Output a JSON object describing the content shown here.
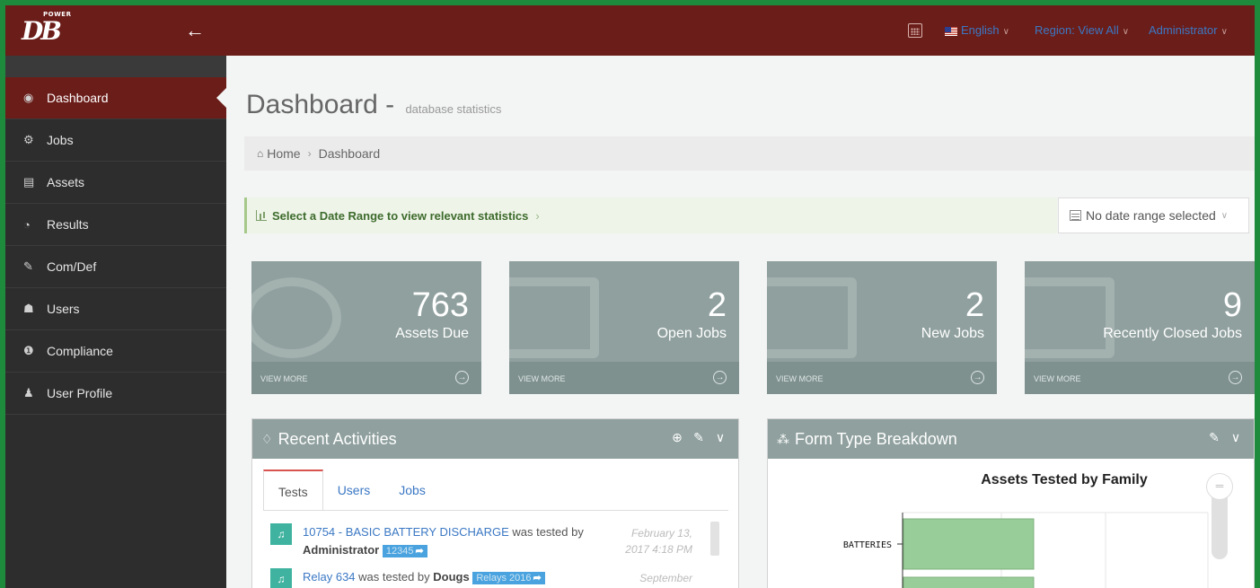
{
  "topbar": {
    "logo_small": "POWER",
    "logo_big": "DB",
    "language": "English",
    "region": "Region: View All",
    "user": "Administrator"
  },
  "sidebar": {
    "items": [
      {
        "label": "Dashboard",
        "icon": "dashboard-icon",
        "glyph": "◉",
        "active": true
      },
      {
        "label": "Jobs",
        "icon": "jobs-icon",
        "glyph": "⚙",
        "active": false
      },
      {
        "label": "Assets",
        "icon": "assets-icon",
        "glyph": "▤",
        "active": false
      },
      {
        "label": "Results",
        "icon": "results-icon",
        "glyph": "◔",
        "active": false
      },
      {
        "label": "Com/Def",
        "icon": "comments-icon",
        "glyph": "✎",
        "active": false
      },
      {
        "label": "Users",
        "icon": "users-icon",
        "glyph": "☗",
        "active": false
      },
      {
        "label": "Compliance",
        "icon": "info-icon",
        "glyph": "❶",
        "active": false
      },
      {
        "label": "User Profile",
        "icon": "user-icon",
        "glyph": "♟",
        "active": false
      }
    ]
  },
  "header": {
    "title": "Dashboard",
    "separator": " - ",
    "subtitle": "database statistics"
  },
  "breadcrumb": {
    "home": "Home",
    "current": "Dashboard"
  },
  "date_range": {
    "prompt": "Select a Date Range to view relevant statistics",
    "selected": "No date range selected"
  },
  "tiles": [
    {
      "value": "763",
      "label": "Assets Due",
      "more": "VIEW MORE"
    },
    {
      "value": "2",
      "label": "Open Jobs",
      "more": "VIEW MORE"
    },
    {
      "value": "2",
      "label": "New Jobs",
      "more": "VIEW MORE"
    },
    {
      "value": "9",
      "label": "Recently Closed Jobs",
      "more": "VIEW MORE"
    }
  ],
  "activities": {
    "title": "Recent Activities",
    "tabs": [
      "Tests",
      "Users",
      "Jobs"
    ],
    "items": [
      {
        "link": "10754 - BASIC BATTERY DISCHARGE",
        "verb": " was tested by ",
        "who": "Administrator",
        "tag": "12345",
        "time": "February 13, 2017 4:18 PM"
      },
      {
        "link": "Relay 634",
        "verb": " was tested by ",
        "who": "Dougs",
        "tag": "Relays 2016",
        "time": "September"
      }
    ]
  },
  "form_type": {
    "title": "Form Type Breakdown"
  },
  "chart_data": {
    "type": "bar",
    "title": "Assets Tested by Family",
    "orientation": "horizontal",
    "categories": [
      "BATTERIES"
    ],
    "bar_color": "#98cc98"
  }
}
